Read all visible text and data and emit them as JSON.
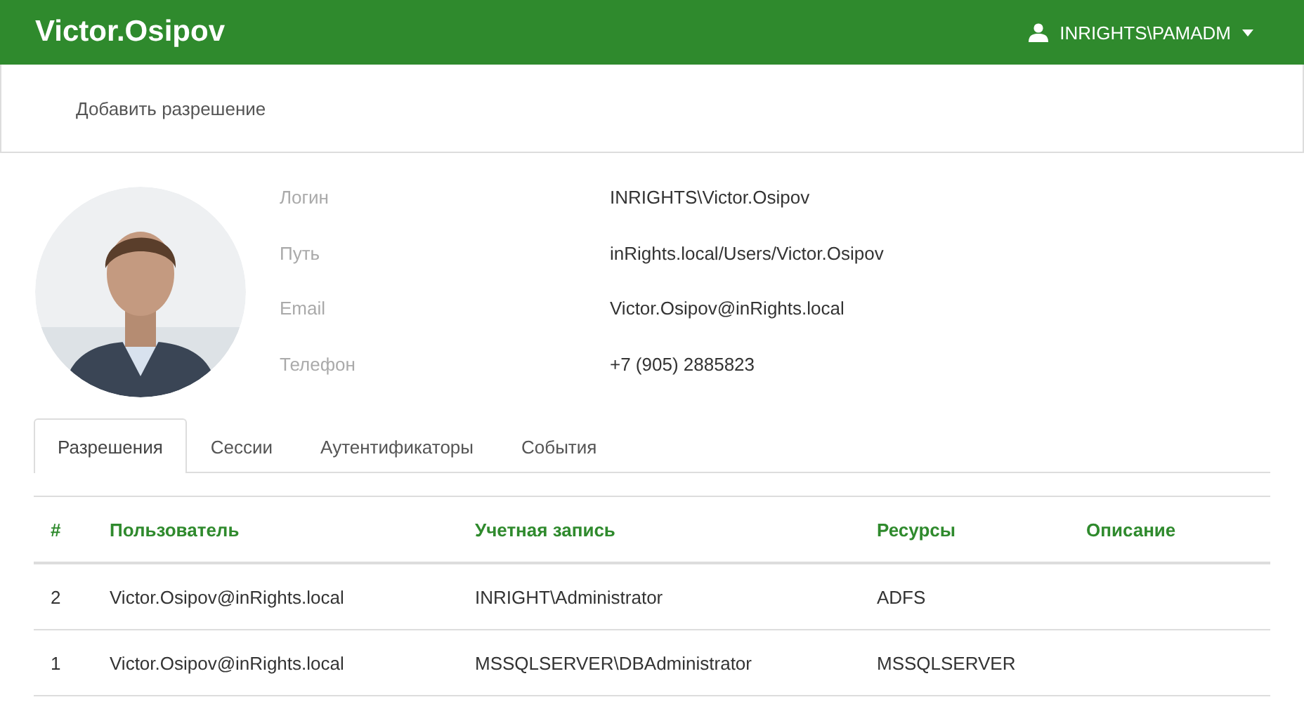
{
  "header": {
    "title": "Victor.Osipov",
    "user": "INRIGHTS\\PAMADM"
  },
  "toolbar": {
    "actions": [
      "Добавить разрешение"
    ]
  },
  "profile": {
    "fields": [
      {
        "label": "Логин",
        "value": "INRIGHTS\\Victor.Osipov"
      },
      {
        "label": "Путь",
        "value": "inRights.local/Users/Victor.Osipov"
      },
      {
        "label": "Email",
        "value": "Victor.Osipov@inRights.local"
      },
      {
        "label": "Телефон",
        "value": "+7 (905) 2885823"
      }
    ]
  },
  "tabs": [
    {
      "label": "Разрешения",
      "selected": true
    },
    {
      "label": "Сессии",
      "selected": false
    },
    {
      "label": "Аутентификаторы",
      "selected": false
    },
    {
      "label": "События",
      "selected": false
    }
  ],
  "table": {
    "columns": [
      "#",
      "Пользователь",
      "Учетная запись",
      "Ресурсы",
      "Описание"
    ],
    "rows": [
      [
        "2",
        "Victor.Osipov@inRights.local",
        "INRIGHT\\Administrator",
        "ADFS"
      ],
      [
        "1",
        "Victor.Osipov@inRights.local",
        "MSSQLSERVER\\DBAdministrator",
        "MSSQLSERVER"
      ]
    ]
  }
}
